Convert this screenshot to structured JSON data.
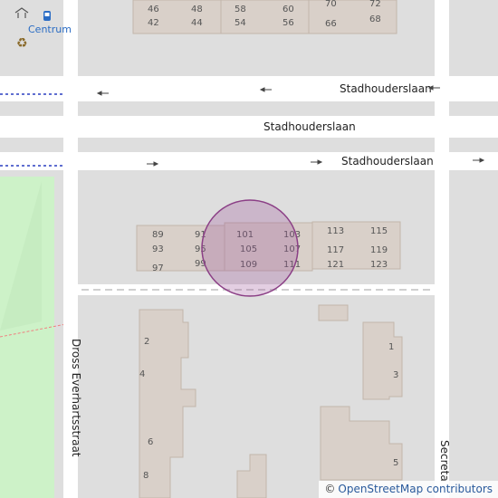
{
  "map": {
    "streets": {
      "top_label_1": "Stadhouderslaan",
      "top_label_2": "Stadhouderslaan",
      "top_label_3": "Stadhouderslaan",
      "left_vertical": "Dross Everhartsstraat",
      "right_vertical": "Secreta"
    },
    "poi": {
      "label": "Centrum",
      "icons": [
        "bus-stop-icon",
        "shelter-icon",
        "recycling-icon"
      ]
    },
    "house_numbers": {
      "top_row_top": [
        "46",
        "48",
        "58",
        "60",
        "70",
        "72"
      ],
      "top_row_bottom": [
        "42",
        "44",
        "54",
        "56",
        "66",
        "68"
      ],
      "block_left": [
        "89",
        "93",
        "97",
        "91",
        "95",
        "99"
      ],
      "block_mid": [
        "101",
        "105",
        "109",
        "103",
        "107",
        "111"
      ],
      "block_right": [
        "113",
        "117",
        "121",
        "115",
        "119",
        "123"
      ],
      "lower_left": [
        "2",
        "4",
        "6",
        "8"
      ],
      "lower_right": [
        "1",
        "3",
        "5"
      ]
    },
    "highlight": {
      "color": "#9b4f96"
    },
    "colors": {
      "road": "#ffffff",
      "block": "#d9d0c9",
      "park": "#c8facc",
      "background": "#e0dfdf"
    }
  },
  "attribution": {
    "symbol": "©",
    "text": "OpenStreetMap contributors"
  }
}
